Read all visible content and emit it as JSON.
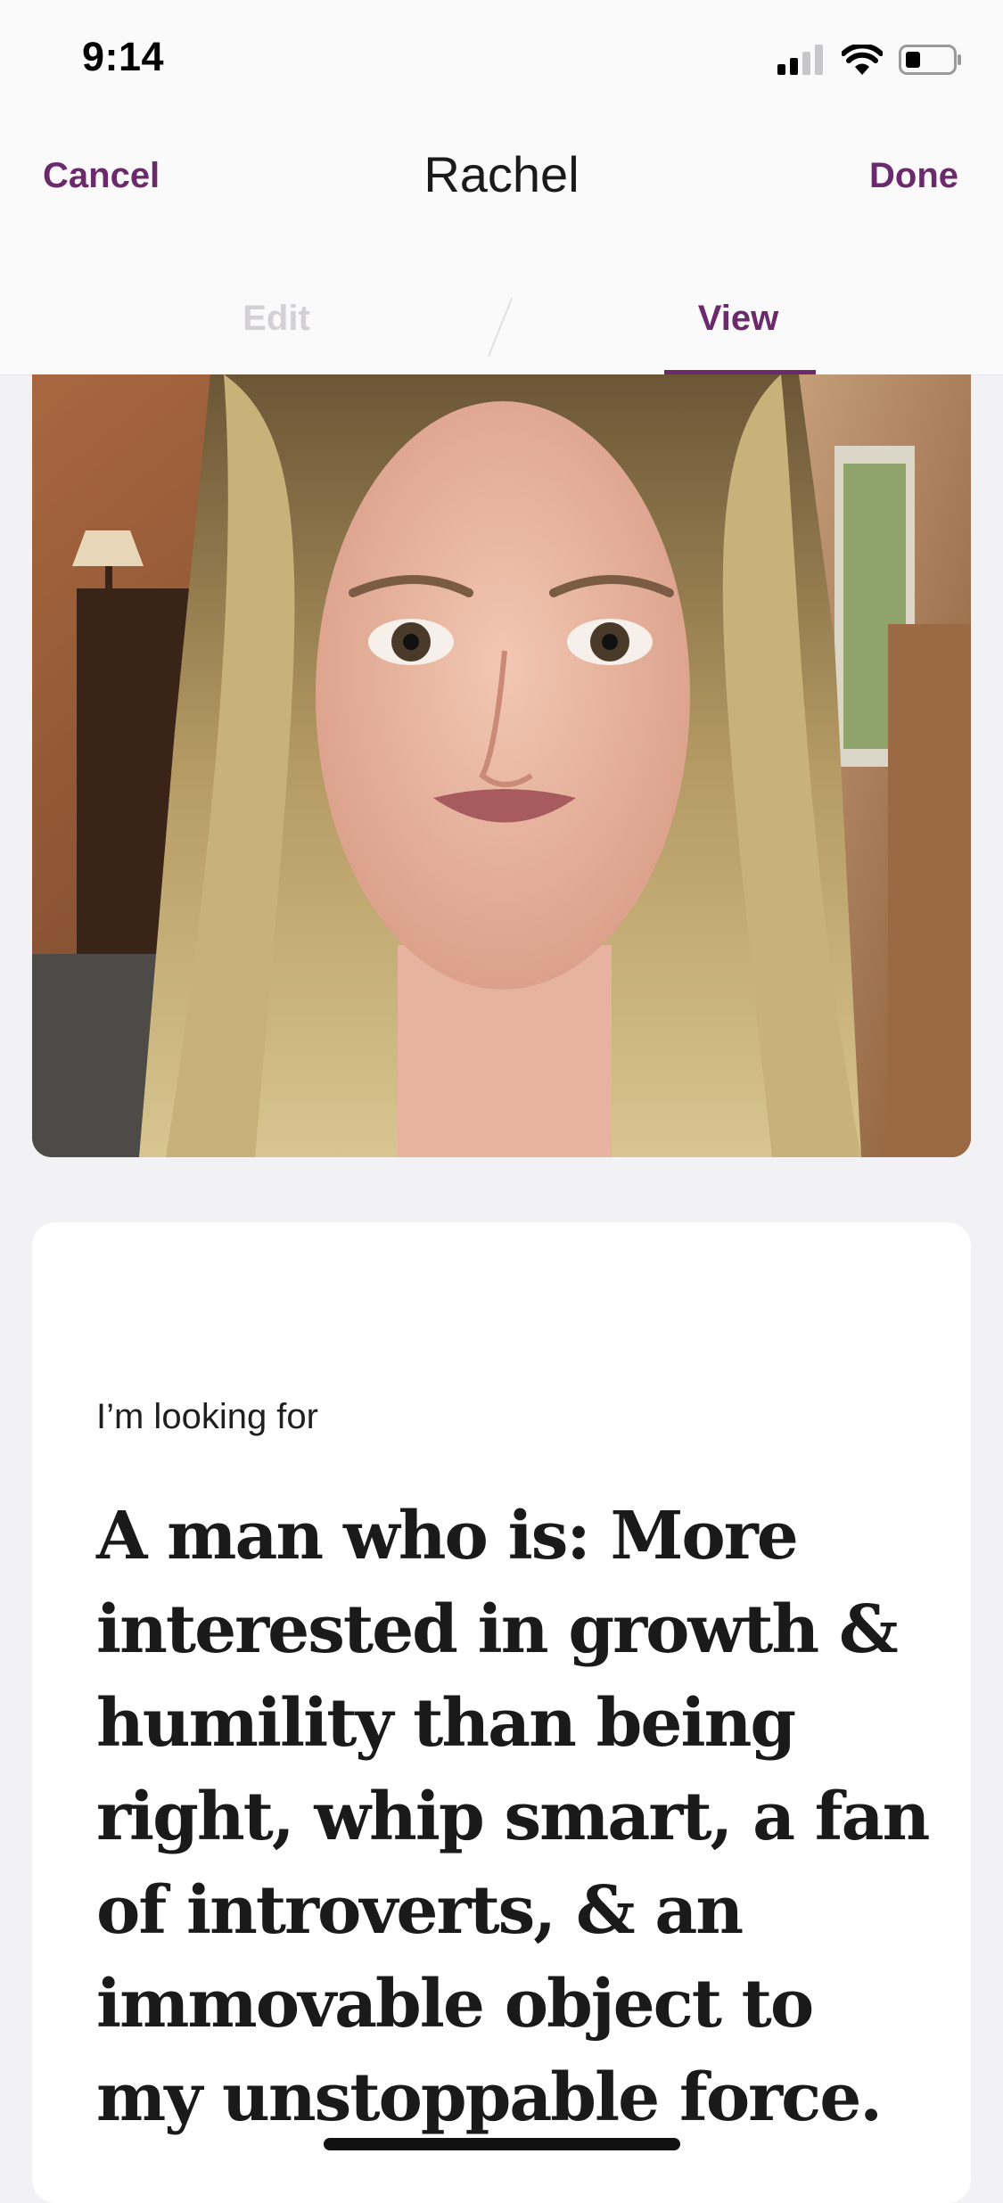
{
  "status_bar": {
    "time": "9:14",
    "icons": [
      "cellular-signal-icon",
      "wifi-icon",
      "battery-icon"
    ]
  },
  "nav": {
    "cancel_label": "Cancel",
    "title": "Rachel",
    "done_label": "Done"
  },
  "tabs": [
    {
      "label": "Edit",
      "active": false
    },
    {
      "label": "View",
      "active": true
    }
  ],
  "photo": {
    "subject": "selfie-photo"
  },
  "prompt_card": {
    "label": "I’m looking for",
    "answer": "A man who is: More interested in growth & humility than being right, whip smart, a fan of introverts, & an immovable object to my unstoppable force."
  },
  "colors": {
    "accent": "#6b2a6b",
    "inactive_tab": "#d3d1d5",
    "background": "#f2f1f3",
    "card": "#ffffff"
  }
}
